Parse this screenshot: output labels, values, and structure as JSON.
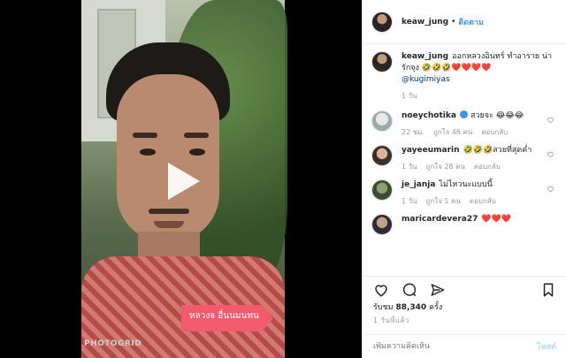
{
  "video": {
    "watermark": "PHOTOGRID",
    "sticker_text": "หลวงจ อื่นนมนทน"
  },
  "header": {
    "username": "keaw_jung",
    "separator": "•",
    "follow_label": "ติดตาม"
  },
  "caption": {
    "username": "keaw_jung",
    "text": "ออกหลวงอินทร์ ทำอาราย น่ารักจุง 🤣🤣🤣❤️❤️❤️❤️",
    "mention": "@kugimiyas",
    "time": "1 วัน"
  },
  "comments": [
    {
      "username": "noeychotika",
      "text": "สวยจะ 😂😂😂",
      "time": "22 ชม.",
      "likes": "ถูกใจ 46 คน",
      "reply": "ตอบกลับ"
    },
    {
      "username": "yayeeumarin",
      "text": "🤣🤣🤣สวยที่สุดค่ำ",
      "time": "1 วัน",
      "likes": "ถูกใจ 28 คน",
      "reply": "ตอบกลับ"
    },
    {
      "username": "je_janja",
      "text": "ไม่ไหวนะแบบนี้",
      "time": "1 วัน",
      "likes": "ถูกใจ 1 คน",
      "reply": "ตอบกลับ"
    },
    {
      "username": "maricardevera27",
      "text": "❤️❤️❤️",
      "time": "",
      "likes": "",
      "reply": ""
    }
  ],
  "stats": {
    "views_label": "รับชม",
    "views_count": "88,340",
    "views_suffix": "ครั้ง",
    "posted": "1 วันที่แล้ว"
  },
  "add_comment": {
    "placeholder": "เพิ่มความคิดเห็น",
    "post_label": "โพสต์"
  },
  "colors": {
    "accent": "#3897f0",
    "muted": "#999999"
  }
}
